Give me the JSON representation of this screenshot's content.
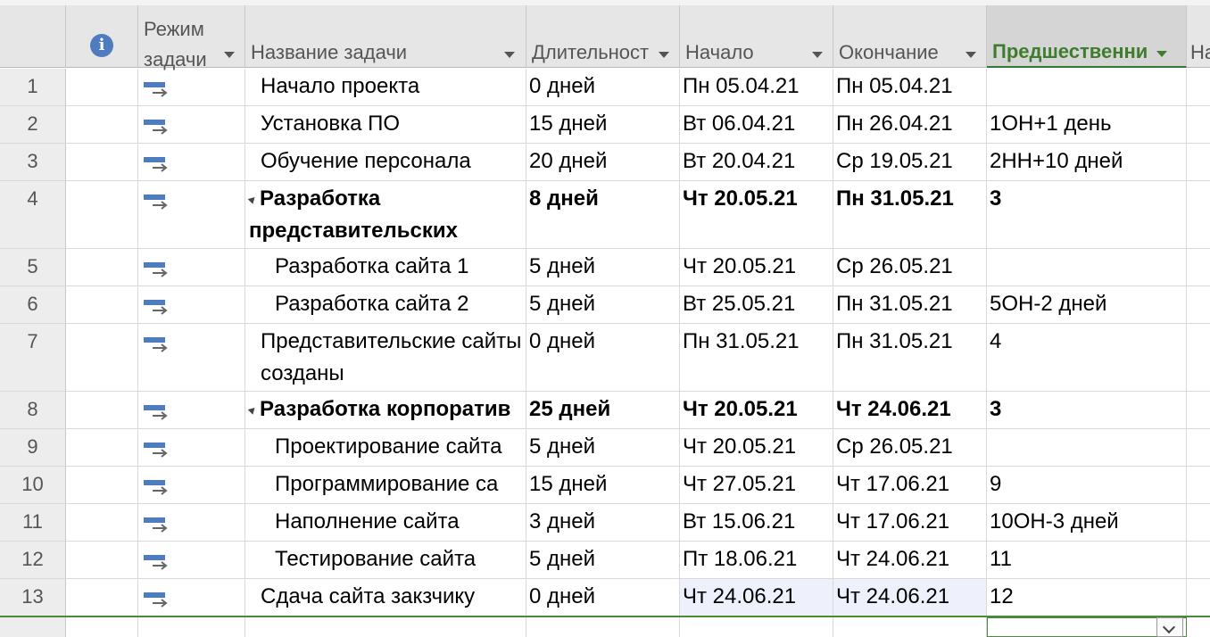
{
  "headers": {
    "mode_line1": "Режим",
    "mode_line2": "задачи",
    "name": "Название задачи",
    "duration": "Длительност",
    "start": "Начало",
    "finish": "Окончание",
    "predecessors": "Предшественни",
    "next_col": "На"
  },
  "icons": {
    "info": "info-icon",
    "task_mode": "auto-scheduled-task-icon"
  },
  "colors": {
    "accent": "#3e7d2e",
    "info": "#4f7bbf",
    "mode_icon": "#4f7bbf",
    "selected_cell": "#eef1fb"
  },
  "rows": [
    {
      "id": "1",
      "name": "Начало проекта",
      "duration": "0 дней",
      "start": "Пн 05.04.21",
      "finish": "Пн 05.04.21",
      "pred": "",
      "summary": false,
      "indent": 0
    },
    {
      "id": "2",
      "name": "Установка ПО",
      "duration": "15 дней",
      "start": "Вт 06.04.21",
      "finish": "Пн 26.04.21",
      "pred": "1ОН+1 день",
      "summary": false,
      "indent": 0
    },
    {
      "id": "3",
      "name": "Обучение персонала",
      "duration": "20 дней",
      "start": "Вт 20.04.21",
      "finish": "Ср 19.05.21",
      "pred": "2НН+10 дней",
      "summary": false,
      "indent": 0
    },
    {
      "id": "4",
      "name": "Разработка представительских",
      "duration": "8 дней",
      "start": "Чт 20.05.21",
      "finish": "Пн 31.05.21",
      "pred": "3",
      "summary": true,
      "indent": 0
    },
    {
      "id": "5",
      "name": "Разработка сайта 1",
      "duration": "5 дней",
      "start": "Чт 20.05.21",
      "finish": "Ср 26.05.21",
      "pred": "",
      "summary": false,
      "indent": 1
    },
    {
      "id": "6",
      "name": "Разработка сайта 2",
      "duration": "5 дней",
      "start": "Вт 25.05.21",
      "finish": "Пн 31.05.21",
      "pred": "5ОН-2 дней",
      "summary": false,
      "indent": 1
    },
    {
      "id": "7",
      "name": "Представительские сайты созданы",
      "duration": "0 дней",
      "start": "Пн 31.05.21",
      "finish": "Пн 31.05.21",
      "pred": "4",
      "summary": false,
      "indent": 0
    },
    {
      "id": "8",
      "name": "Разработка корпоратив",
      "duration": "25 дней",
      "start": "Чт 20.05.21",
      "finish": "Чт 24.06.21",
      "pred": "3",
      "summary": true,
      "indent": 0
    },
    {
      "id": "9",
      "name": "Проектирование сайта",
      "duration": "5 дней",
      "start": "Чт 20.05.21",
      "finish": "Ср 26.05.21",
      "pred": "",
      "summary": false,
      "indent": 1
    },
    {
      "id": "10",
      "name": "Программирование са",
      "duration": "15 дней",
      "start": "Чт 27.05.21",
      "finish": "Чт 17.06.21",
      "pred": "9",
      "summary": false,
      "indent": 1
    },
    {
      "id": "11",
      "name": "Наполнение сайта",
      "duration": "3 дней",
      "start": "Вт 15.06.21",
      "finish": "Чт 17.06.21",
      "pred": "10ОН-3 дней",
      "summary": false,
      "indent": 1
    },
    {
      "id": "12",
      "name": "Тестирование сайта",
      "duration": "5 дней",
      "start": "Пт 18.06.21",
      "finish": "Чт 24.06.21",
      "pred": "11",
      "summary": false,
      "indent": 1
    },
    {
      "id": "13",
      "name": "Сдача сайта закзчику",
      "duration": "0 дней",
      "start": "Чт 24.06.21",
      "finish": "Чт 24.06.21",
      "pred": "12",
      "summary": false,
      "indent": 0
    }
  ]
}
